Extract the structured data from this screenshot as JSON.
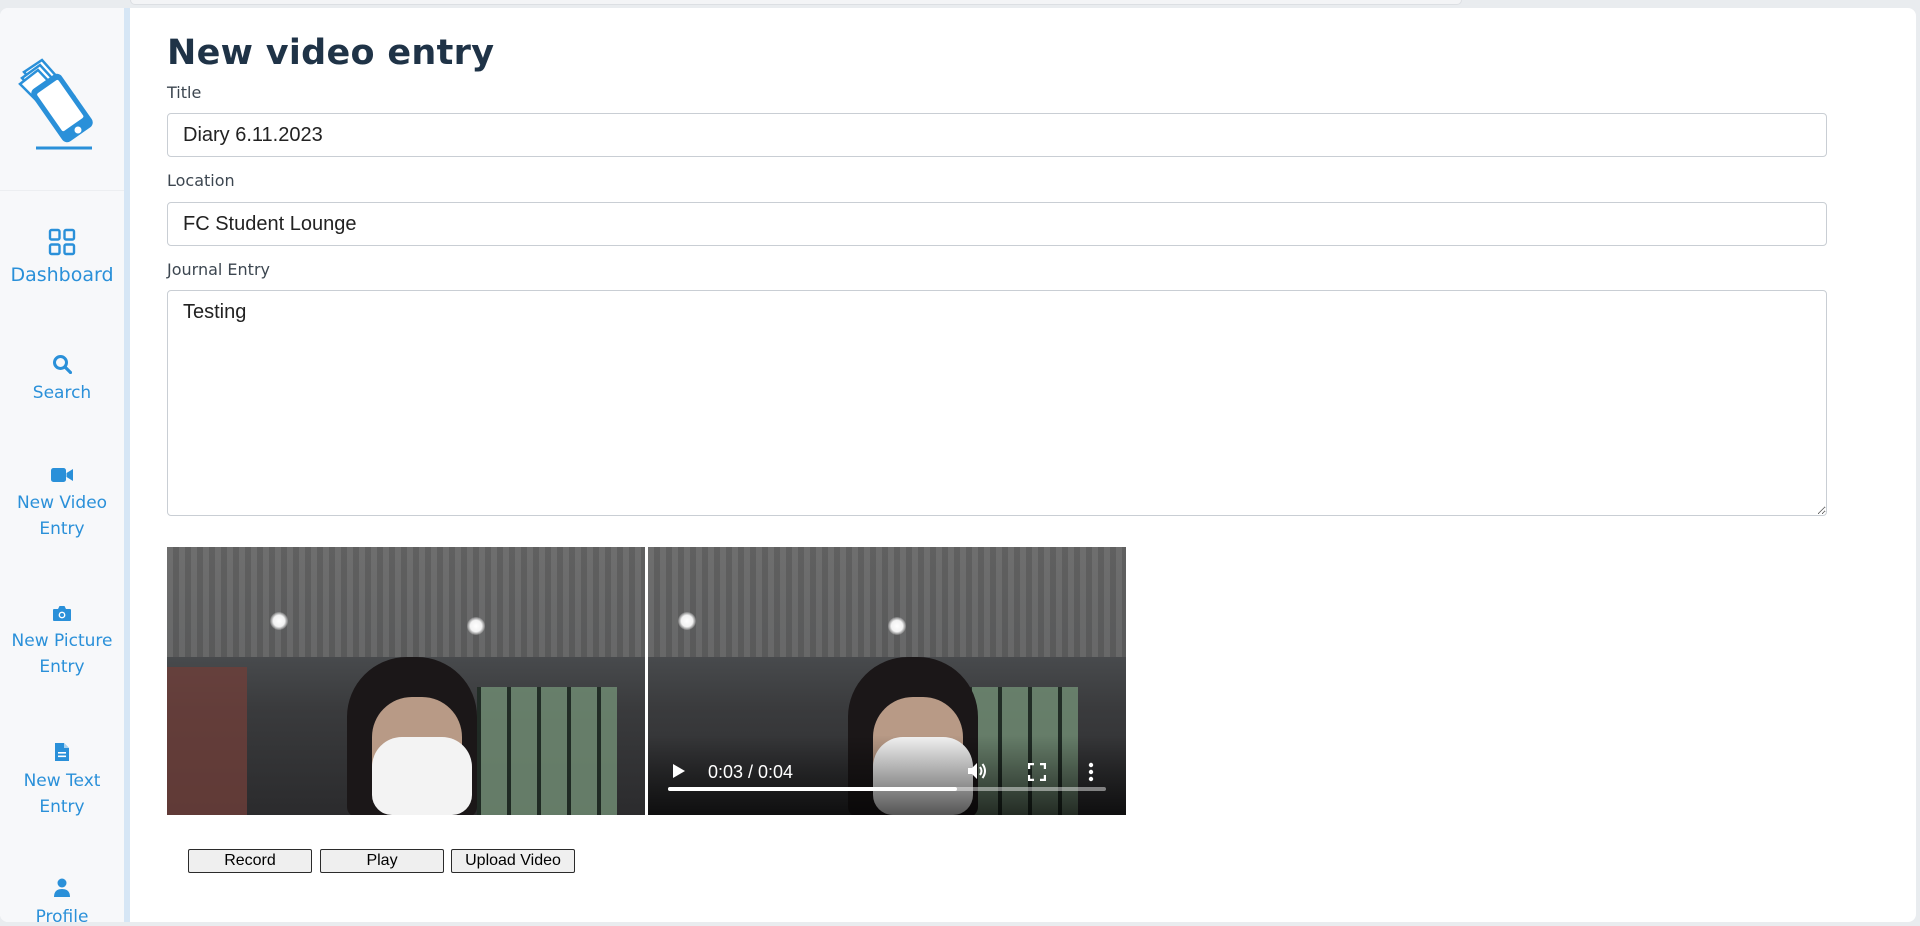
{
  "sidebar": {
    "items": [
      {
        "label": "Dashboard",
        "icon": "grid-icon"
      },
      {
        "label": "Search",
        "icon": "search-icon"
      },
      {
        "label": "New Video\nEntry",
        "icon": "video-camera-icon"
      },
      {
        "label": "New Picture\nEntry",
        "icon": "camera-icon"
      },
      {
        "label": "New Text\nEntry",
        "icon": "document-icon"
      },
      {
        "label": "Profile",
        "icon": "user-icon"
      }
    ],
    "accent_color": "#2a90d9"
  },
  "page": {
    "title": "New video entry"
  },
  "form": {
    "title_label": "Title",
    "title_value": "Diary 6.11.2023",
    "location_label": "Location",
    "location_value": "FC Student Lounge",
    "journal_label": "Journal Entry",
    "journal_value": "Testing"
  },
  "player": {
    "time": "0:03 / 0:04",
    "progress": 0.66
  },
  "buttons": {
    "record": "Record",
    "play": "Play",
    "upload": "Upload Video"
  }
}
